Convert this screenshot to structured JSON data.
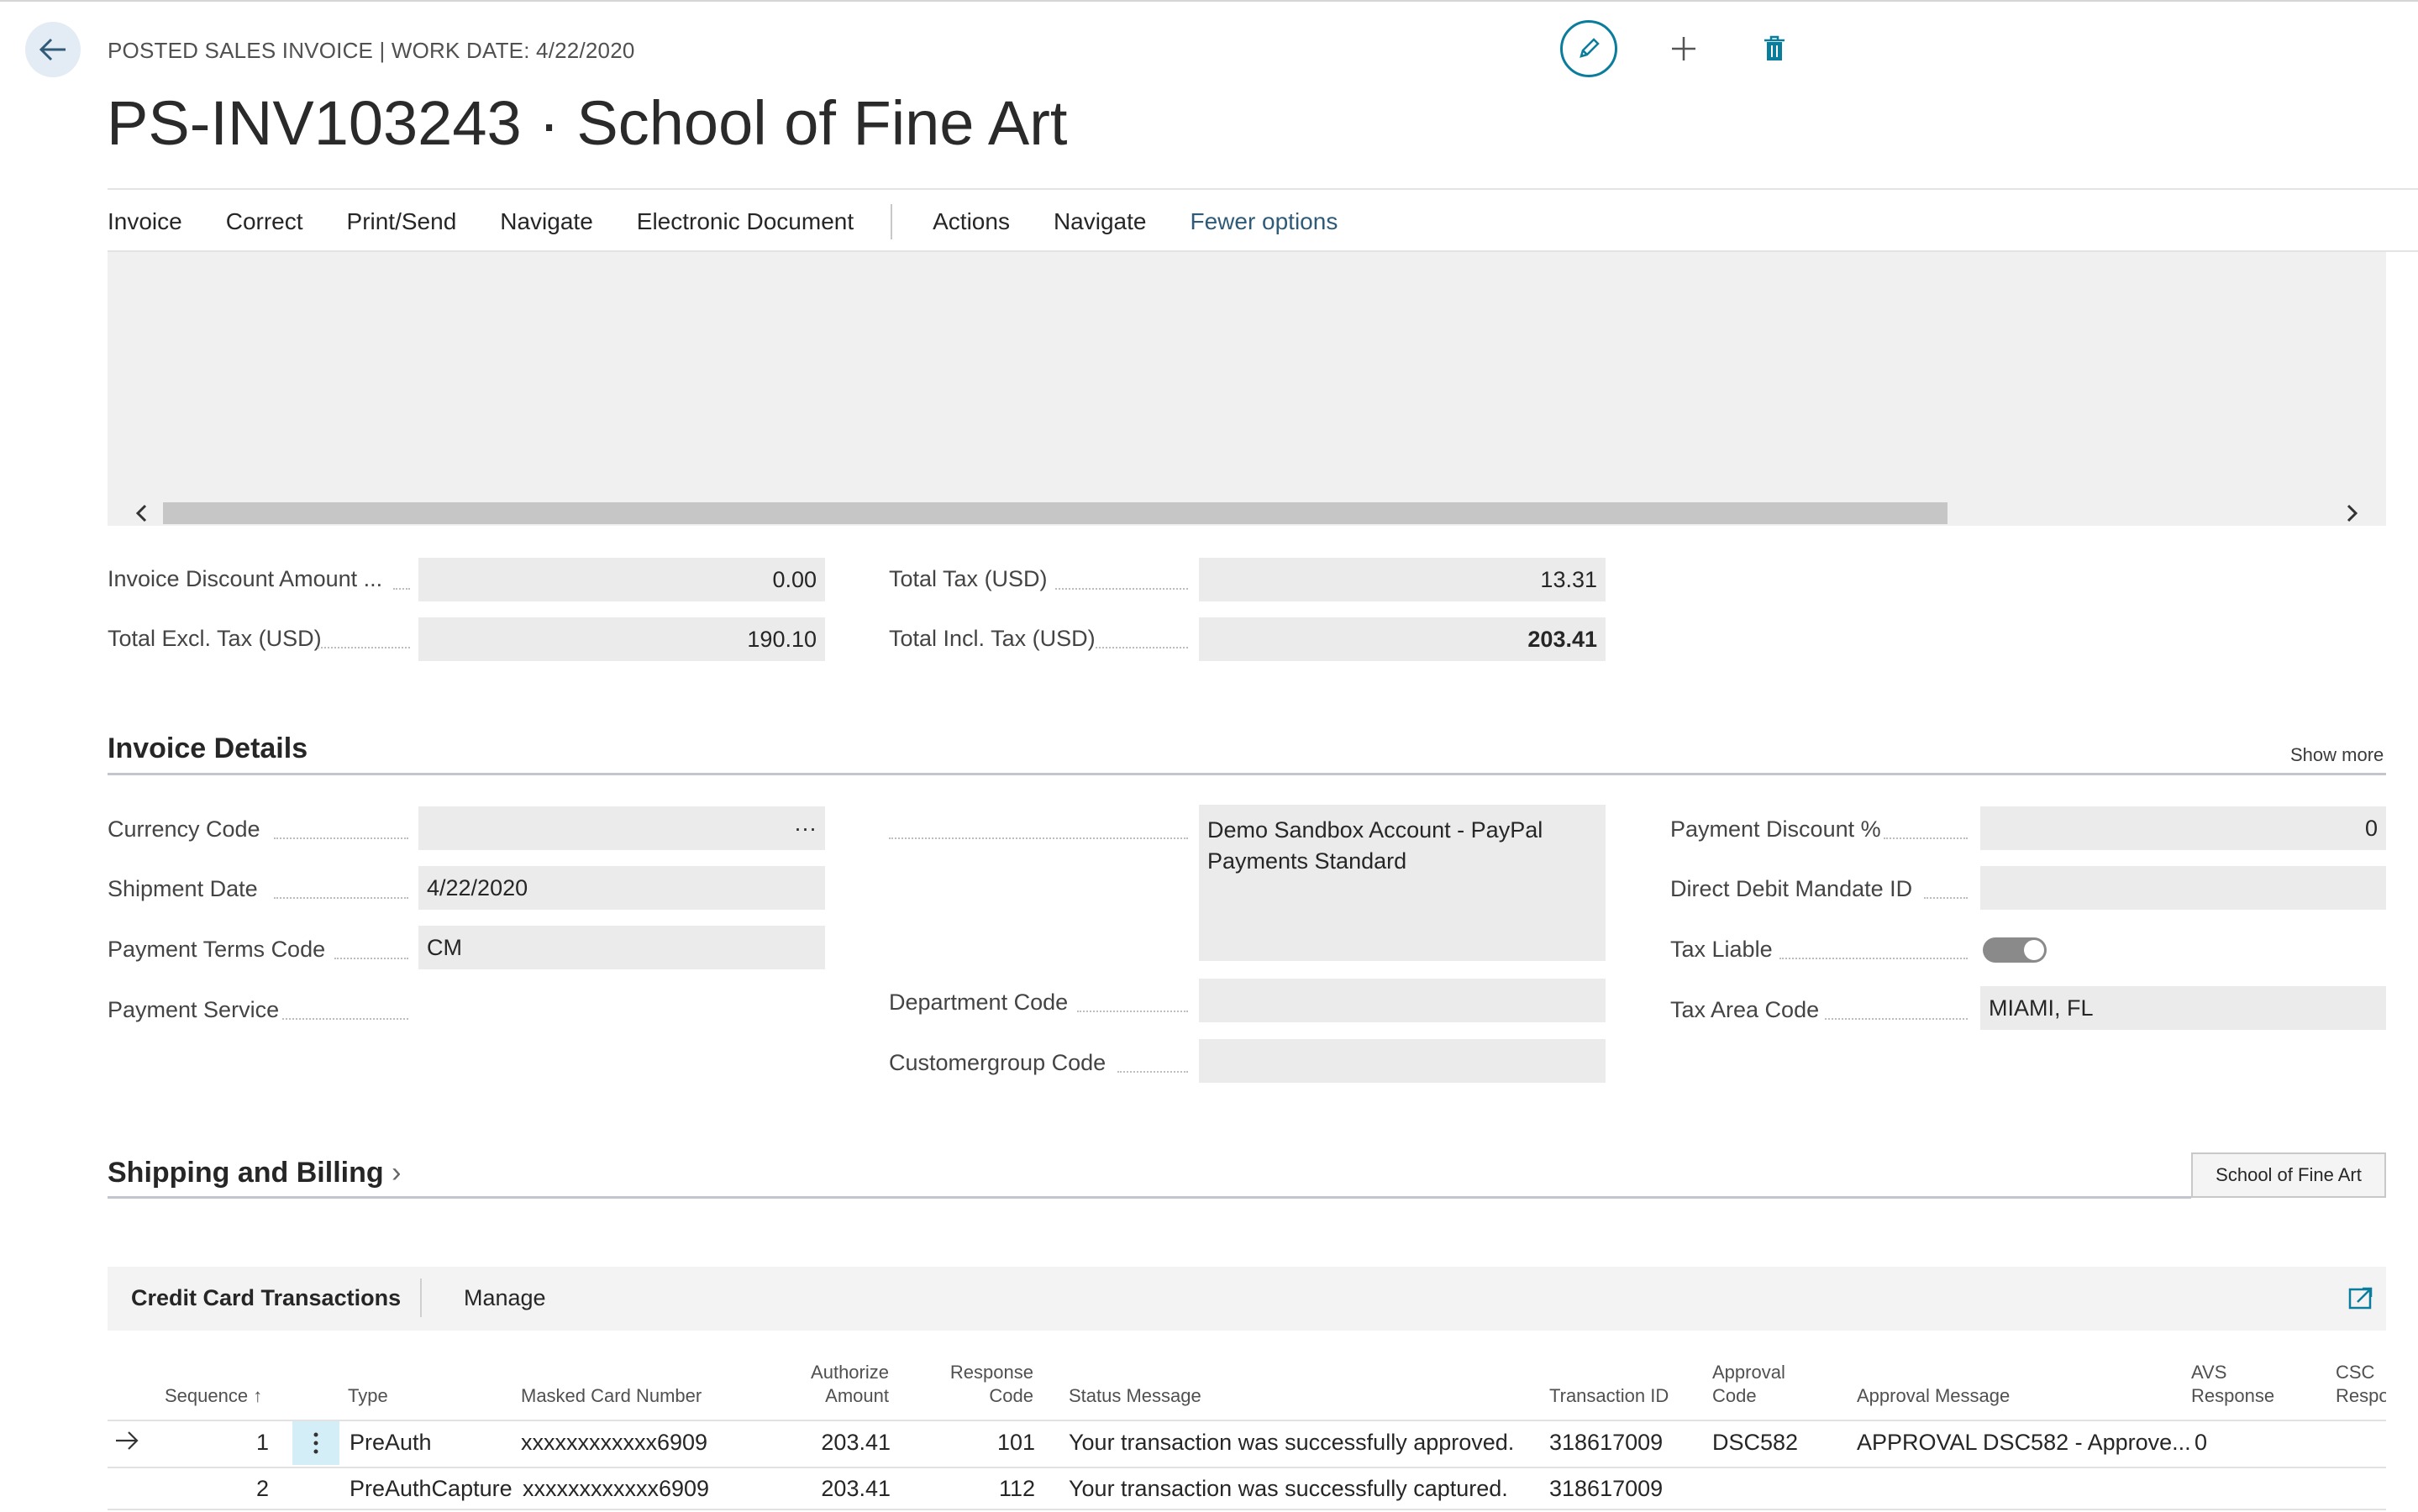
{
  "header": {
    "caption": "POSTED SALES INVOICE | WORK DATE: 4/22/2020",
    "title": "PS-INV103243 · School of Fine Art"
  },
  "actions": {
    "menu": [
      "Invoice",
      "Correct",
      "Print/Send",
      "Navigate",
      "Electronic Document"
    ],
    "menu2": [
      "Actions",
      "Navigate"
    ],
    "fewer": "Fewer options"
  },
  "totals": {
    "invoice_discount_label": "Invoice Discount Amount ...",
    "invoice_discount_value": "0.00",
    "total_excl_label": "Total Excl. Tax (USD)",
    "total_excl_value": "190.10",
    "total_tax_label": "Total Tax (USD)",
    "total_tax_value": "13.31",
    "total_incl_label": "Total Incl. Tax (USD)",
    "total_incl_value": "203.41"
  },
  "details": {
    "title": "Invoice Details",
    "show_more": "Show more",
    "currency_code_label": "Currency Code",
    "currency_code_button": "···",
    "shipment_date_label": "Shipment Date",
    "shipment_date_value": "4/22/2020",
    "payment_terms_label": "Payment Terms Code",
    "payment_terms_value": "CM",
    "payment_service_label": "Payment Service",
    "payment_service_value_line1": "Demo Sandbox Account - PayPal",
    "payment_service_value_line2": "Payments Standard",
    "department_label": "Department Code",
    "customergroup_label": "Customergroup Code",
    "payment_discount_label": "Payment Discount %",
    "payment_discount_value": "0",
    "direct_debit_label": "Direct Debit Mandate ID",
    "tax_liable_label": "Tax Liable",
    "tax_liable_on": true,
    "tax_area_label": "Tax Area Code",
    "tax_area_value": "MIAMI, FL"
  },
  "shipping": {
    "title": "Shipping and Billing",
    "chevron": "›",
    "button": "School of Fine Art"
  },
  "cc": {
    "tab1": "Credit Card Transactions",
    "tab2": "Manage",
    "headers": {
      "sequence": "Sequence",
      "sort_arrow": "↑",
      "type": "Type",
      "masked": "Masked Card Number",
      "auth1": "Authorize",
      "auth2": "Amount",
      "resp1": "Response",
      "resp2": "Code",
      "status": "Status Message",
      "txid": "Transaction ID",
      "appr1": "Approval",
      "appr2": "Code",
      "apprmsg": "Approval Message",
      "avs1": "AVS",
      "avs2": "Response",
      "csc1": "CSC",
      "csc2": "Respo"
    },
    "rows": [
      {
        "sequence": "1",
        "type": "PreAuth",
        "masked": "xxxxxxxxxxxx6909",
        "amount": "203.41",
        "code": "101",
        "status": "Your transaction was successfully approved.",
        "txid": "318617009",
        "approval": "DSC582",
        "approval_msg": "APPROVAL DSC582 - Approve...",
        "avs": "0"
      },
      {
        "sequence": "2",
        "type": "PreAuthCapture",
        "masked": "xxxxxxxxxxxx6909",
        "amount": "203.41",
        "code": "112",
        "status": "Your transaction was successfully captured.",
        "txid": "318617009",
        "approval": "",
        "approval_msg": "",
        "avs": ""
      }
    ]
  },
  "colors": {
    "accent": "#0a7c9c",
    "field_bg": "#ebebeb"
  }
}
